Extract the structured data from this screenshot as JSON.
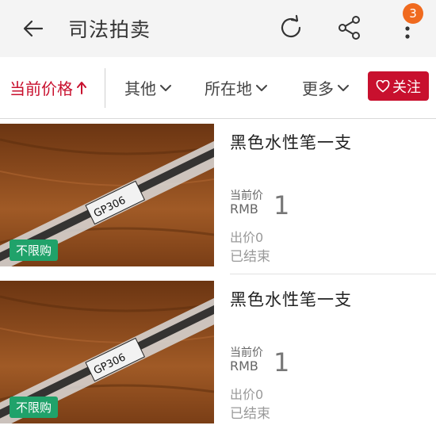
{
  "header": {
    "title": "司法拍卖",
    "badge_count": "3"
  },
  "filters": {
    "price": "当前价格",
    "other": "其他",
    "location": "所在地",
    "more": "更多",
    "follow": "关注"
  },
  "items": [
    {
      "title": "黑色水性笔一支",
      "current_label": "当前价",
      "currency": "RMB",
      "price": "1",
      "bids": "出价0",
      "status": "已结束",
      "tag": "不限购",
      "pen_text": "GP306"
    },
    {
      "title": "黑色水性笔一支",
      "current_label": "当前价",
      "currency": "RMB",
      "price": "1",
      "bids": "出价0",
      "status": "已结束",
      "tag": "不限购",
      "pen_text": "GP306"
    }
  ],
  "colors": {
    "accent": "#c8102e",
    "badge": "#f06a1e",
    "tag": "#20a26a"
  }
}
